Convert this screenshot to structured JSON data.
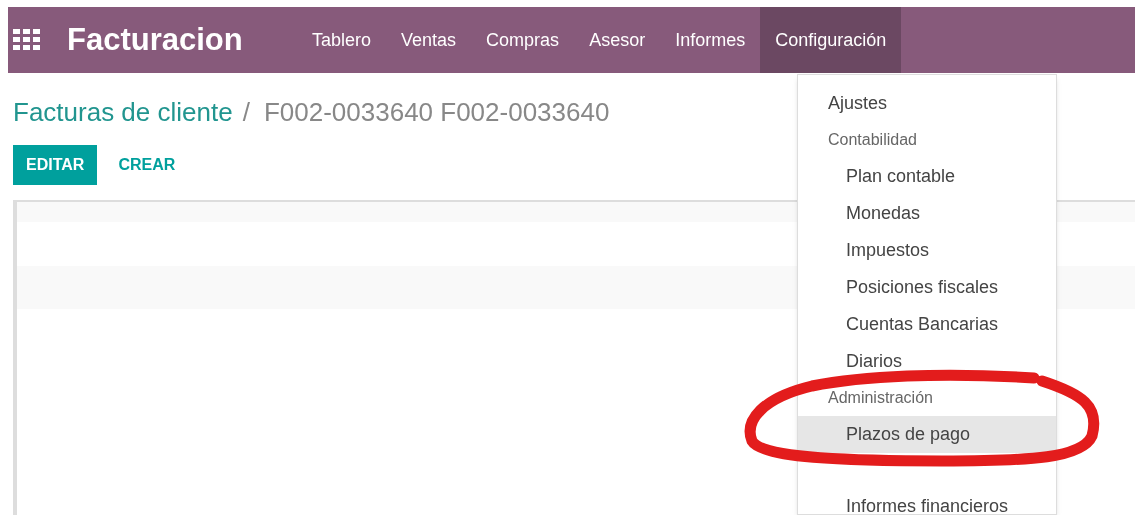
{
  "navbar": {
    "app_title": "Facturacion",
    "menus": [
      {
        "label": "Tablero",
        "selected": false
      },
      {
        "label": "Ventas",
        "selected": false
      },
      {
        "label": "Compras",
        "selected": false
      },
      {
        "label": "Asesor",
        "selected": false
      },
      {
        "label": "Informes",
        "selected": false
      },
      {
        "label": "Configuración",
        "selected": true
      }
    ]
  },
  "breadcrumb": {
    "parent": "Facturas de cliente",
    "separator": "/",
    "current": "F002-0033640 F002-0033640"
  },
  "buttons": [
    {
      "label": "EDITAR",
      "kind": "primary"
    },
    {
      "label": "CREAR",
      "kind": "link"
    }
  ],
  "dropdown": {
    "items": [
      {
        "kind": "item",
        "label": "Ajustes",
        "selected": false
      },
      {
        "kind": "header",
        "label": "Contabilidad"
      },
      {
        "kind": "subitem",
        "label": "Plan contable",
        "selected": false
      },
      {
        "kind": "subitem",
        "label": "Monedas",
        "selected": false
      },
      {
        "kind": "subitem",
        "label": "Impuestos",
        "selected": false
      },
      {
        "kind": "subitem",
        "label": "Posiciones fiscales",
        "selected": false
      },
      {
        "kind": "subitem",
        "label": "Cuentas Bancarias",
        "selected": false
      },
      {
        "kind": "subitem",
        "label": "Diarios",
        "selected": false
      },
      {
        "kind": "header",
        "label": "Administración"
      },
      {
        "kind": "subitem",
        "label": "Plazos de pago",
        "selected": true
      },
      {
        "kind": "divider"
      },
      {
        "kind": "subitem",
        "label": "Informes financieros",
        "selected": false
      }
    ]
  }
}
